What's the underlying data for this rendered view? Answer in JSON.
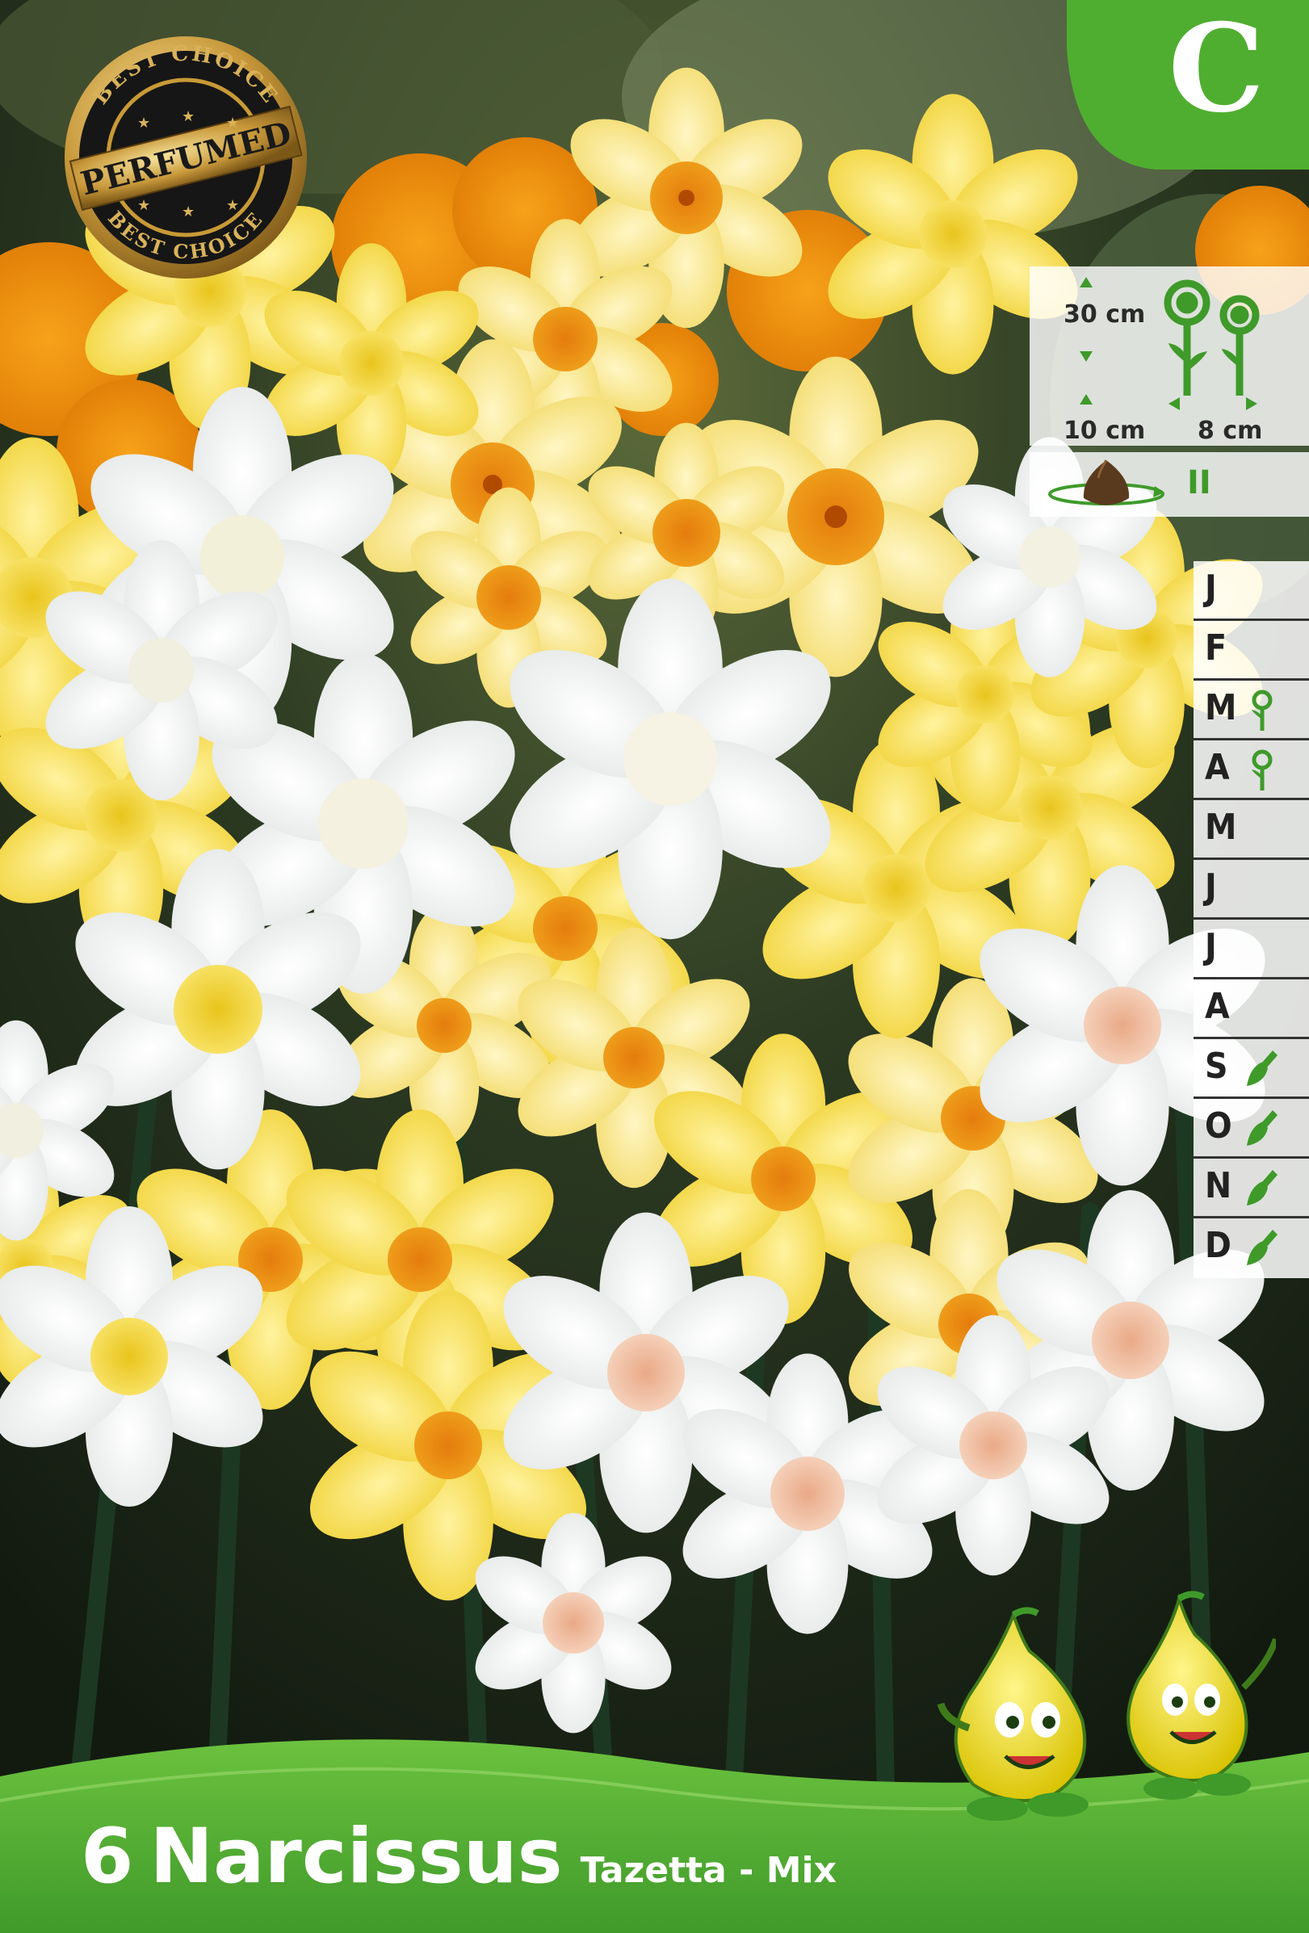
{
  "badge": {
    "top_text": "BEST CHOICE",
    "center_text": "PERFUMED",
    "bottom_text": "BEST CHOICE",
    "icon": "perfumed-seal-icon"
  },
  "class_letter": "C",
  "planting_info": {
    "plant_height": "30 cm",
    "planting_depth": "10 cm",
    "plant_spacing": "8 cm",
    "perennial_mark": "II",
    "icons": [
      "flower-height-icon",
      "bulb-rotation-icon"
    ]
  },
  "calendar": {
    "months": [
      {
        "letter": "J",
        "icon": ""
      },
      {
        "letter": "F",
        "icon": ""
      },
      {
        "letter": "M",
        "icon": "flower-icon"
      },
      {
        "letter": "A",
        "icon": "flower-icon"
      },
      {
        "letter": "M",
        "icon": ""
      },
      {
        "letter": "J",
        "icon": ""
      },
      {
        "letter": "J",
        "icon": ""
      },
      {
        "letter": "A",
        "icon": ""
      },
      {
        "letter": "S",
        "icon": "trowel-icon"
      },
      {
        "letter": "O",
        "icon": "trowel-icon"
      },
      {
        "letter": "N",
        "icon": "trowel-icon"
      },
      {
        "letter": "D",
        "icon": "trowel-icon"
      }
    ]
  },
  "title": {
    "count": "6",
    "name": "Narcissus",
    "variety": "Tazetta - Mix"
  },
  "colors": {
    "brand_green": "#4fae2f",
    "icon_green": "#3f9a2a",
    "bulb_brown": "#5a3a1e"
  }
}
